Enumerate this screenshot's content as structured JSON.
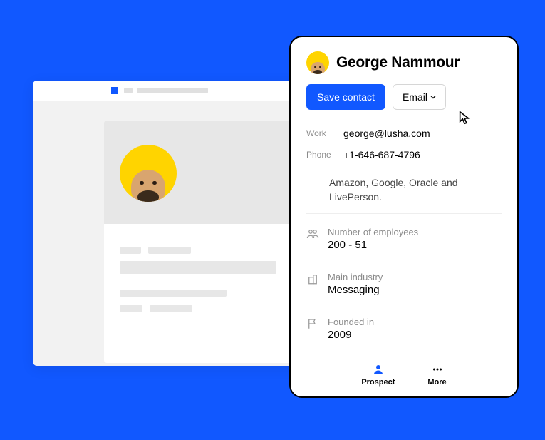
{
  "contact": {
    "name": "George Nammour",
    "save_label": "Save contact",
    "email_btn_label": "Email",
    "work_label": "Work",
    "work_email": "george@lusha.com",
    "phone_label": "Phone",
    "phone_number": "+1-646-687-4796",
    "summary_partial": "Amazon, Google, Oracle and LivePerson."
  },
  "details": {
    "employees_label": "Number of employees",
    "employees_value": "200 - 51",
    "industry_label": "Main industry",
    "industry_value": "Messaging",
    "founded_label": "Founded in",
    "founded_value": "2009"
  },
  "nav": {
    "prospect": "Prospect",
    "more": "More"
  }
}
